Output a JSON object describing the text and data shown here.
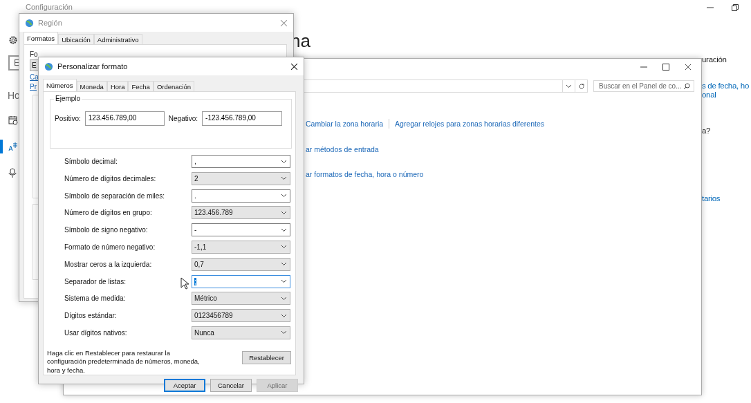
{
  "settings": {
    "title": "Configuración",
    "search_text": "E",
    "section_label": "Ho",
    "heading": "na",
    "nav": [
      {
        "kind": "date",
        "selected": false
      },
      {
        "kind": "language",
        "selected": true
      },
      {
        "kind": "speech",
        "selected": false
      }
    ],
    "right_texts": [
      {
        "text": "uración",
        "kind": "text"
      },
      {
        "text": "s de fecha, ho",
        "kind": "link"
      },
      {
        "text": "onal",
        "kind": "link"
      },
      {
        "text": "a?",
        "kind": "text"
      },
      {
        "text": "tarios",
        "kind": "link"
      }
    ]
  },
  "control_panel": {
    "search": {
      "placeholder": "Buscar en el Panel de co..."
    },
    "link_rows": [
      [
        "Cambiar la zona horaria",
        "Agregar relojes para zonas horarias diferentes"
      ],
      [
        "ar métodos de entrada"
      ],
      [
        "ar formatos de fecha, hora o número"
      ]
    ]
  },
  "region": {
    "title": "Región",
    "tabs": [
      {
        "label": "Formatos",
        "selected": true
      },
      {
        "label": "Ubicación",
        "selected": false
      },
      {
        "label": "Administrativo",
        "selected": false
      }
    ],
    "label": "Fo",
    "combo": "E",
    "links": [
      "Ca",
      "Pr"
    ]
  },
  "custom_format": {
    "title": "Personalizar formato",
    "tabs": [
      {
        "label": "Números",
        "selected": true
      },
      {
        "label": "Moneda",
        "selected": false
      },
      {
        "label": "Hora",
        "selected": false
      },
      {
        "label": "Fecha",
        "selected": false
      },
      {
        "label": "Ordenación",
        "selected": false
      }
    ],
    "example": {
      "title": "Ejemplo",
      "positive_label": "Positivo:",
      "positive": "123.456.789,00",
      "negative_label": "Negativo:",
      "negative": "-123.456.789,00"
    },
    "settings": [
      {
        "label": "Símbolo decimal:",
        "value": ",",
        "kind": "editable",
        "focused": false
      },
      {
        "label": "Número de dígitos decimales:",
        "value": "2",
        "kind": "list",
        "focused": false
      },
      {
        "label": "Símbolo de separación de miles:",
        "value": ".",
        "kind": "editable",
        "focused": false
      },
      {
        "label": "Número de dígitos en grupo:",
        "value": "123.456.789",
        "kind": "list",
        "focused": false
      },
      {
        "label": "Símbolo de signo negativo:",
        "value": "-",
        "kind": "editable",
        "focused": false
      },
      {
        "label": "Formato de número negativo:",
        "value": "-1,1",
        "kind": "list",
        "focused": false
      },
      {
        "label": "Mostrar ceros a la izquierda:",
        "value": "0,7",
        "kind": "list",
        "focused": false
      },
      {
        "label": "Separador de listas:",
        "value": ";",
        "kind": "editable",
        "focused": true
      },
      {
        "label": "Sistema de medida:",
        "value": "Métrico",
        "kind": "list",
        "focused": false
      },
      {
        "label": "Dígitos estándar:",
        "value": "0123456789",
        "kind": "list",
        "focused": false
      },
      {
        "label": "Usar dígitos nativos:",
        "value": "Nunca",
        "kind": "list",
        "focused": false
      }
    ],
    "note": "Haga clic en Restablecer para restaurar la configuración predeterminada de números, moneda, hora y fecha.",
    "reset_button": "Restablecer",
    "buttons": [
      {
        "label": "Aceptar",
        "default": true,
        "disabled": false
      },
      {
        "label": "Cancelar",
        "default": false,
        "disabled": false
      },
      {
        "label": "Aplicar",
        "default": false,
        "disabled": true
      }
    ]
  }
}
